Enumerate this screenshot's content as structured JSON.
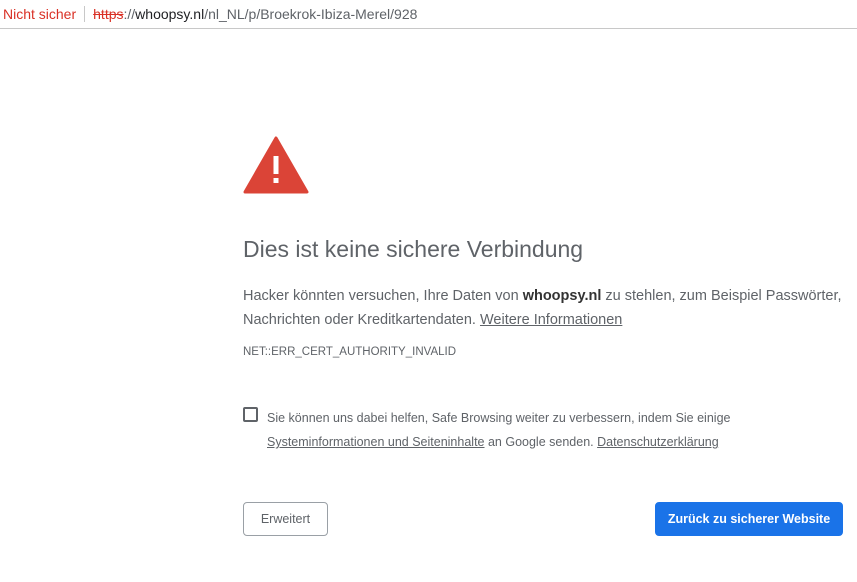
{
  "addressbar": {
    "security_label": "Nicht sicher",
    "url_scheme": "https",
    "url_sep": "://",
    "url_host": "whoopsy.nl",
    "url_path": "/nl_NL/p/Broekrok-Ibiza-Merel/928"
  },
  "interstitial": {
    "heading": "Dies ist keine sichere Verbindung",
    "explanation_before": "Hacker könnten versuchen, Ihre Daten von ",
    "explanation_host": "whoopsy.nl",
    "explanation_after": " zu stehlen, zum Beispiel Passwörter, Nachrichten oder Kreditkartendaten. ",
    "learn_more_link": "Weitere Informationen",
    "error_code": "NET::ERR_CERT_AUTHORITY_INVALID",
    "safe_browsing": {
      "text_before": "Sie können uns dabei helfen, Safe Browsing weiter zu verbessern, indem Sie einige ",
      "system_info_link": "Systeminformationen und Seiteninhalte",
      "text_after": " an Google senden. ",
      "privacy_link": "Datenschutzerklärung",
      "checked": false
    },
    "advanced_button": "Erweitert",
    "back_button": "Zurück zu sicherer Website"
  },
  "colors": {
    "not_secure": "#d93025",
    "primary_button": "#1a73e8",
    "warning_icon": "#db4437"
  },
  "icons": {
    "warning": "warning-triangle-icon"
  }
}
